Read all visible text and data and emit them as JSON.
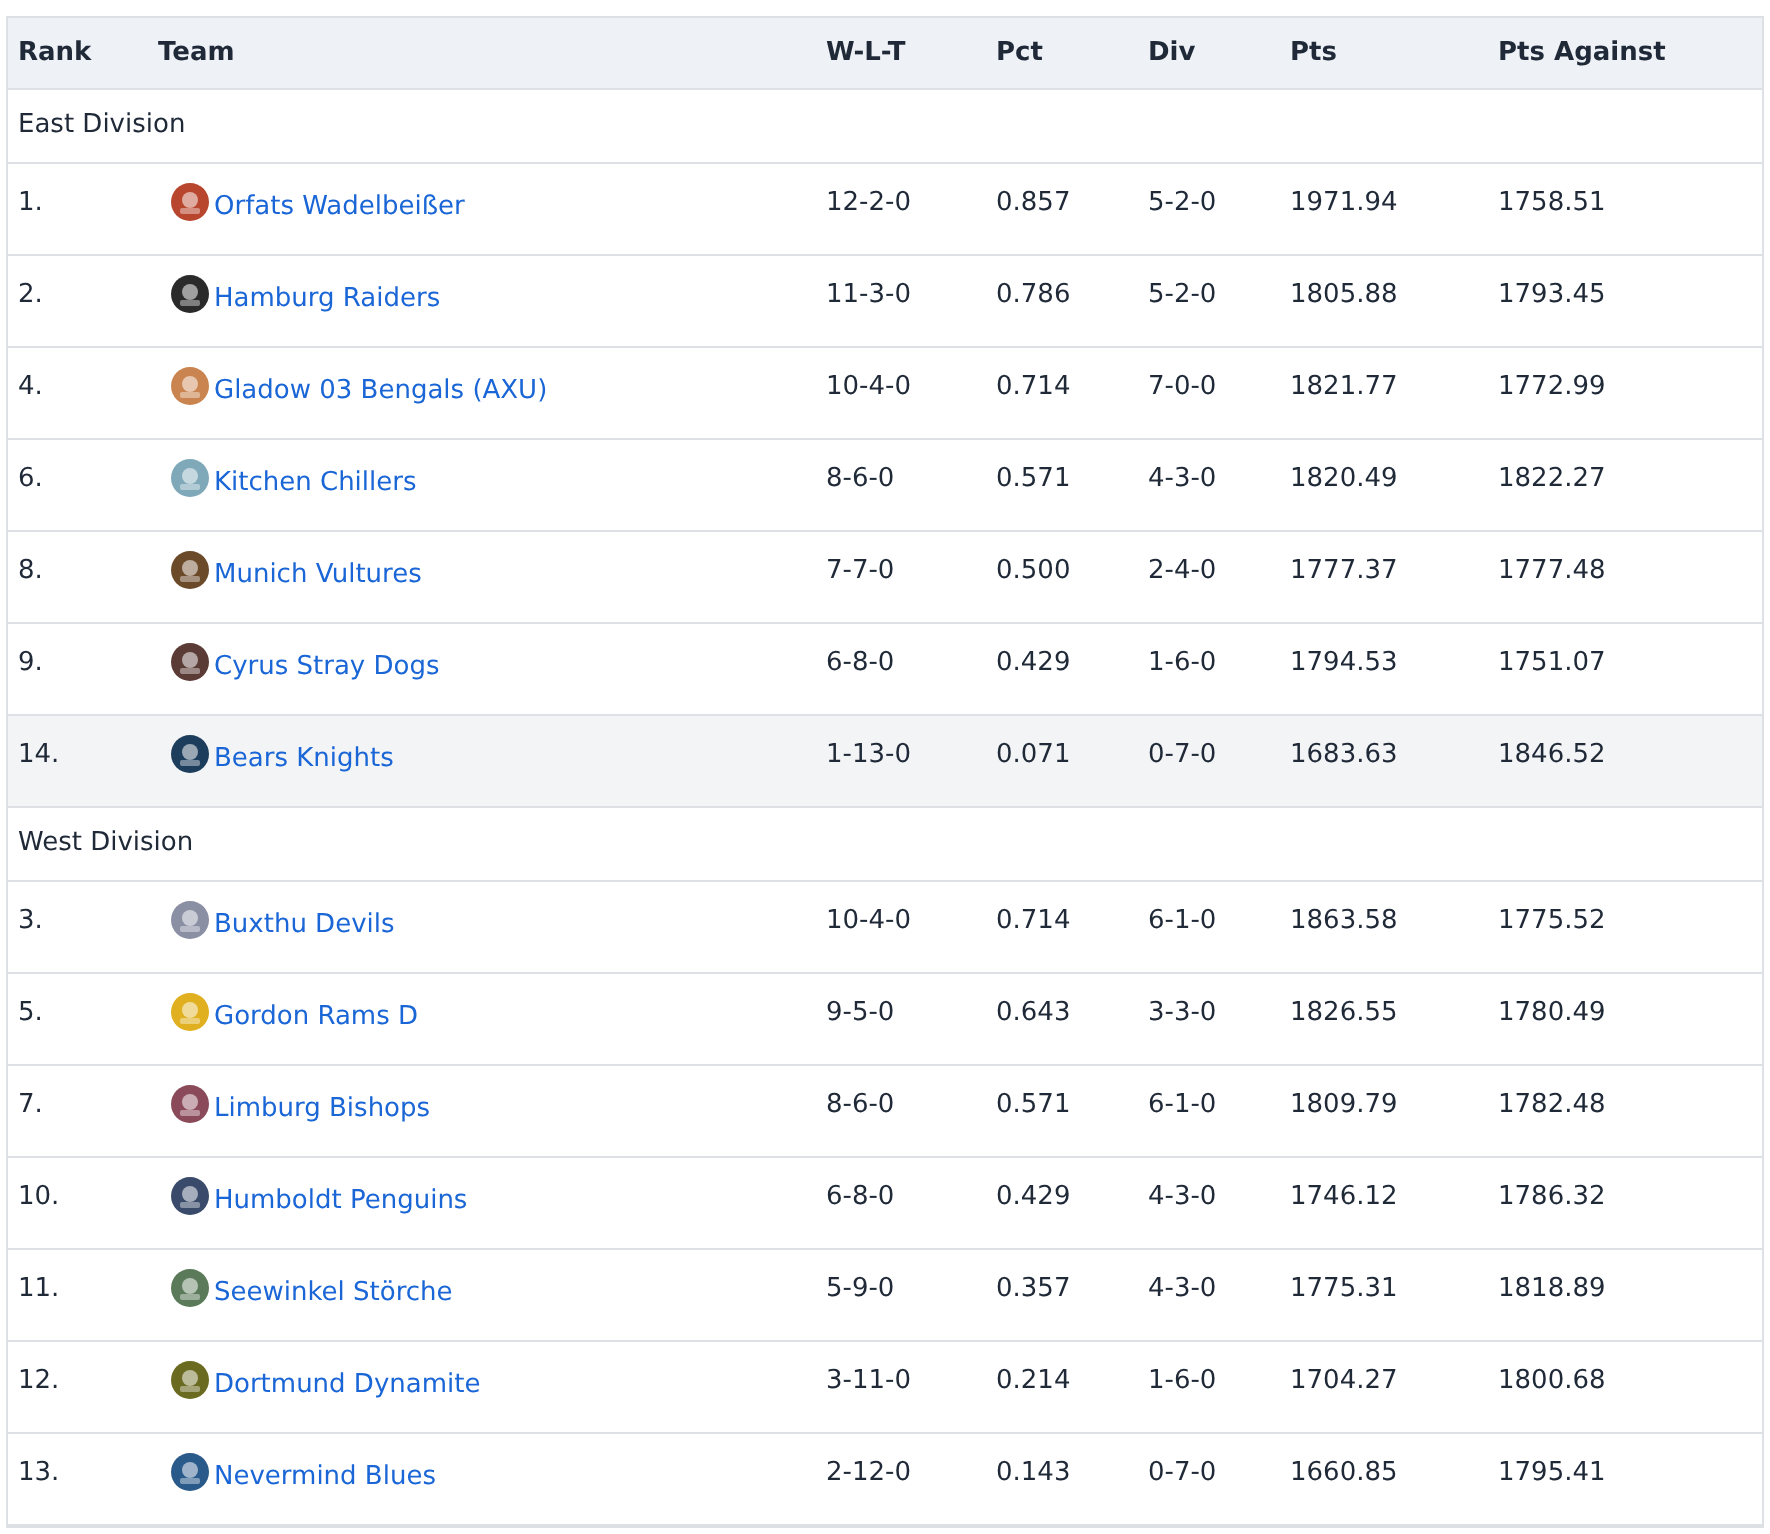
{
  "table": {
    "columns": [
      "Rank",
      "Team",
      "W-L-T",
      "Pct",
      "Div",
      "Pts",
      "Pts Against"
    ],
    "divisions": [
      {
        "name": "East Division",
        "rows": [
          {
            "rank": "1.",
            "team": "Orfats Wadelbeißer",
            "color": "#b8452e",
            "wlt": "12-2-0",
            "pct": "0.857",
            "div": "5-2-0",
            "pts": "1971.94",
            "pts_against": "1758.51",
            "highlighted": false
          },
          {
            "rank": "2.",
            "team": "Hamburg Raiders",
            "color": "#2a2a2a",
            "wlt": "11-3-0",
            "pct": "0.786",
            "div": "5-2-0",
            "pts": "1805.88",
            "pts_against": "1793.45",
            "highlighted": false
          },
          {
            "rank": "4.",
            "team": "Gladow 03 Bengals (AXU)",
            "color": "#c9844f",
            "wlt": "10-4-0",
            "pct": "0.714",
            "div": "7-0-0",
            "pts": "1821.77",
            "pts_against": "1772.99",
            "highlighted": false
          },
          {
            "rank": "6.",
            "team": "Kitchen Chillers",
            "color": "#7fa9b8",
            "wlt": "8-6-0",
            "pct": "0.571",
            "div": "4-3-0",
            "pts": "1820.49",
            "pts_against": "1822.27",
            "highlighted": false
          },
          {
            "rank": "8.",
            "team": "Munich Vultures",
            "color": "#6b4a2a",
            "wlt": "7-7-0",
            "pct": "0.500",
            "div": "2-4-0",
            "pts": "1777.37",
            "pts_against": "1777.48",
            "highlighted": false
          },
          {
            "rank": "9.",
            "team": "Cyrus Stray Dogs",
            "color": "#5a3b35",
            "wlt": "6-8-0",
            "pct": "0.429",
            "div": "1-6-0",
            "pts": "1794.53",
            "pts_against": "1751.07",
            "highlighted": false
          },
          {
            "rank": "14.",
            "team": "Bears Knights",
            "color": "#1d3d5c",
            "wlt": "1-13-0",
            "pct": "0.071",
            "div": "0-7-0",
            "pts": "1683.63",
            "pts_against": "1846.52",
            "highlighted": true
          }
        ]
      },
      {
        "name": "West Division",
        "rows": [
          {
            "rank": "3.",
            "team": "Buxthu Devils",
            "color": "#8a8fa3",
            "wlt": "10-4-0",
            "pct": "0.714",
            "div": "6-1-0",
            "pts": "1863.58",
            "pts_against": "1775.52",
            "highlighted": false
          },
          {
            "rank": "5.",
            "team": "Gordon Rams D",
            "color": "#e0b020",
            "wlt": "9-5-0",
            "pct": "0.643",
            "div": "3-3-0",
            "pts": "1826.55",
            "pts_against": "1780.49",
            "highlighted": false
          },
          {
            "rank": "7.",
            "team": "Limburg Bishops",
            "color": "#8a4a5a",
            "wlt": "8-6-0",
            "pct": "0.571",
            "div": "6-1-0",
            "pts": "1809.79",
            "pts_against": "1782.48",
            "highlighted": false
          },
          {
            "rank": "10.",
            "team": "Humboldt Penguins",
            "color": "#3a4a6a",
            "wlt": "6-8-0",
            "pct": "0.429",
            "div": "4-3-0",
            "pts": "1746.12",
            "pts_against": "1786.32",
            "highlighted": false
          },
          {
            "rank": "11.",
            "team": "Seewinkel Störche",
            "color": "#5a7a5a",
            "wlt": "5-9-0",
            "pct": "0.357",
            "div": "4-3-0",
            "pts": "1775.31",
            "pts_against": "1818.89",
            "highlighted": false
          },
          {
            "rank": "12.",
            "team": "Dortmund Dynamite",
            "color": "#6a6a20",
            "wlt": "3-11-0",
            "pct": "0.214",
            "div": "1-6-0",
            "pts": "1704.27",
            "pts_against": "1800.68",
            "highlighted": false
          },
          {
            "rank": "13.",
            "team": "Nevermind Blues",
            "color": "#2a5a8a",
            "wlt": "2-12-0",
            "pct": "0.143",
            "div": "0-7-0",
            "pts": "1660.85",
            "pts_against": "1795.41",
            "highlighted": false
          }
        ]
      }
    ]
  }
}
